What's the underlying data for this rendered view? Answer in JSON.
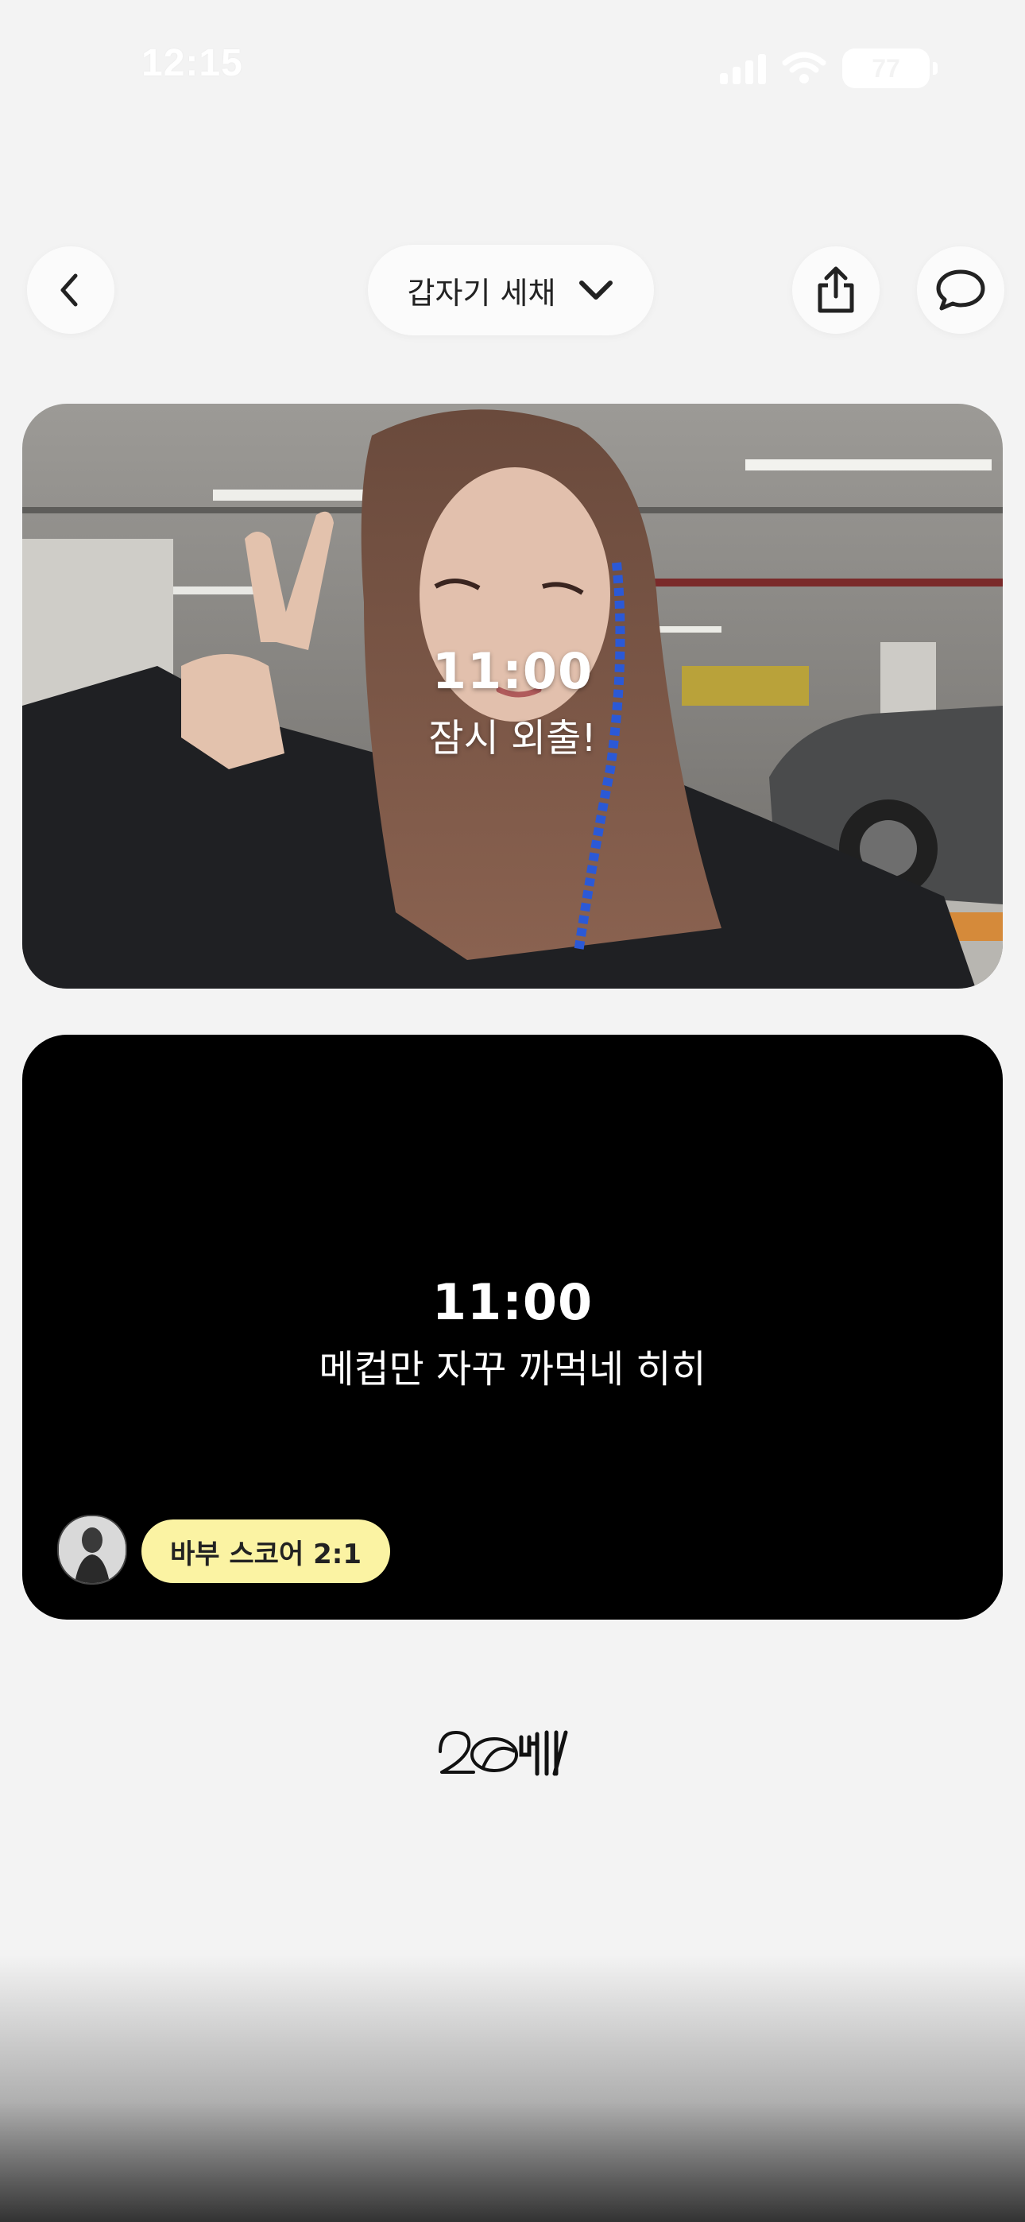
{
  "status_bar": {
    "time": "12:15",
    "battery": "77",
    "icons": [
      "cellular-signal-icon",
      "wifi-icon",
      "battery-icon"
    ]
  },
  "nav": {
    "back_icon": "chevron-left-icon",
    "title": "갑자기 세채",
    "title_icon": "chevron-down-icon",
    "share_icon": "share-icon",
    "comment_icon": "speech-bubble-icon"
  },
  "posts": [
    {
      "time": "11:00",
      "caption": "잠시 외출!",
      "media": "photo"
    },
    {
      "time": "11:00",
      "caption": "메컵만 자꾸 까먹네 히히",
      "media": "black",
      "badge": "바부 스코어 2:1"
    }
  ],
  "footer": {
    "logo": "20th-anniversary-logo"
  },
  "colors": {
    "background": "#f3f3f3",
    "badge": "#fbf3a3",
    "card_black": "#000000"
  }
}
